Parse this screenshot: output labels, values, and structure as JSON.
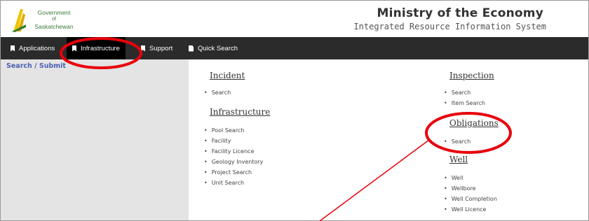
{
  "header": {
    "logo_text": [
      "Government",
      "of",
      "Saskatchewan"
    ],
    "ministry_title": "Ministry of the Economy",
    "system_subtitle": "Integrated Resource Information System"
  },
  "nav": {
    "applications": "Applications",
    "infrastructure": "Infrastructure",
    "support": "Support",
    "quick_search": "Quick Search"
  },
  "sidebar": {
    "link": "Search / Submit"
  },
  "left_column": {
    "incident": {
      "title": "Incident",
      "items": [
        "Search"
      ]
    },
    "infrastructure": {
      "title": "Infrastructure",
      "items": [
        "Pool Search",
        "Facility",
        "Facility Licence",
        "Geology Inventory",
        "Project Search",
        "Unit Search"
      ]
    }
  },
  "right_column": {
    "inspection": {
      "title": "Inspection",
      "items": [
        "Search",
        "Item Search"
      ]
    },
    "obligations": {
      "title": "Obligations",
      "items": [
        "Search"
      ]
    },
    "well": {
      "title": "Well",
      "items": [
        "Well",
        "Wellbore",
        "Well Completion",
        "Well Licence"
      ]
    }
  },
  "colors": {
    "navbar": "#2b2b2b",
    "sidebar": "#e4e4e4",
    "annotation": "#e8000b",
    "link": "#4a5fb5"
  }
}
